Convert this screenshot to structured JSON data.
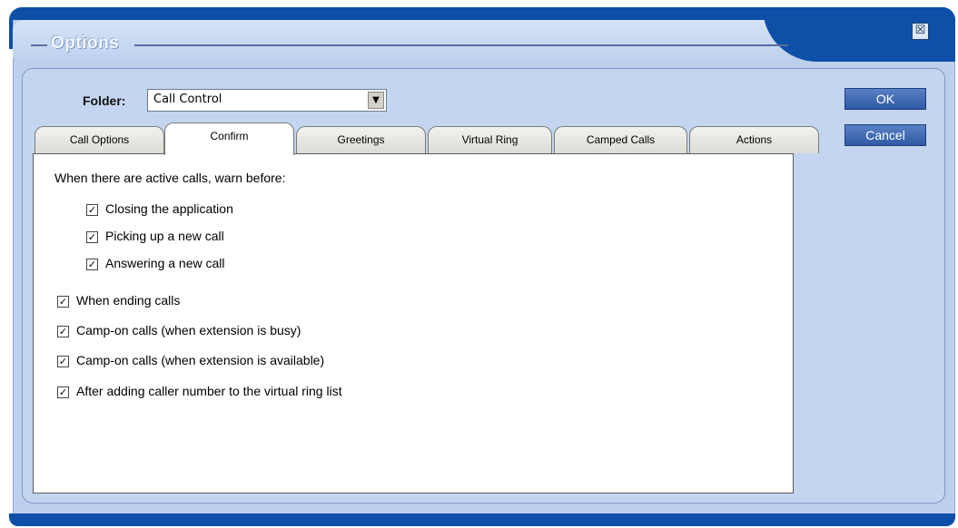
{
  "window": {
    "title": "Options",
    "close_glyph": "☒"
  },
  "folder": {
    "label": "Folder:",
    "value": "Call Control",
    "arrow": "▼"
  },
  "buttons": {
    "ok": "OK",
    "cancel": "Cancel"
  },
  "tabs": [
    {
      "label": "Call Options",
      "active": false
    },
    {
      "label": "Confirm",
      "active": true
    },
    {
      "label": "Greetings",
      "active": false
    },
    {
      "label": "Virtual Ring",
      "active": false
    },
    {
      "label": "Camped Calls",
      "active": false
    },
    {
      "label": "Actions",
      "active": false
    }
  ],
  "confirm": {
    "heading": "When there are active calls, warn before:",
    "check_glyph": "✓",
    "sub_options": [
      {
        "label": "Closing the application",
        "checked": true
      },
      {
        "label": "Picking up a new call",
        "checked": true
      },
      {
        "label": "Answering a new call",
        "checked": true
      }
    ],
    "options": [
      {
        "label": "When ending calls",
        "checked": true
      },
      {
        "label": "Camp-on calls (when extension is busy)",
        "checked": true
      },
      {
        "label": "Camp-on calls (when extension is available)",
        "checked": true
      },
      {
        "label": "After adding caller number to the virtual ring list",
        "checked": true
      }
    ]
  }
}
